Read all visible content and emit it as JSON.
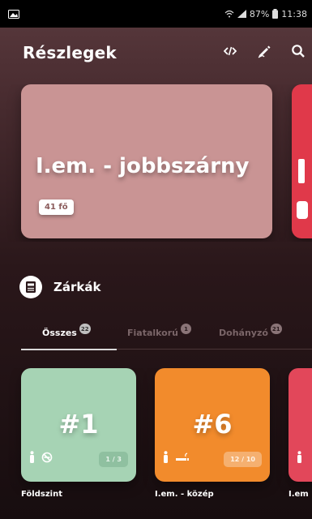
{
  "status": {
    "battery": "87%",
    "time": "11:38"
  },
  "appbar": {
    "title": "Részlegek",
    "icons": [
      "code-icon",
      "pen-icon",
      "search-icon"
    ]
  },
  "departments": [
    {
      "name": "I.em. - jobbszárny",
      "count": "41 fő",
      "color": "#c99494"
    },
    {
      "name": "",
      "count": "",
      "color": "#e0394a"
    }
  ],
  "section": {
    "title": "Zárkák",
    "icon": "cell-door-icon"
  },
  "tabs": [
    {
      "label": "Összes",
      "badge": "22",
      "active": true
    },
    {
      "label": "Fiatalkorú",
      "badge": "1",
      "active": false
    },
    {
      "label": "Dohányzó",
      "badge": "21",
      "active": false
    }
  ],
  "cells": [
    {
      "number": "#1",
      "occupancy": "1 / 3",
      "label": "Földszint",
      "color": "#a6d3b4",
      "pill": "#8fc0a0"
    },
    {
      "number": "#6",
      "occupancy": "12 / 10",
      "label": "I.em. - közép",
      "color": "#f28b2c",
      "pill": "#f5b070"
    },
    {
      "number": "",
      "occupancy": "",
      "label": "I.em",
      "color": "#e2475a",
      "pill": "#e2475a"
    }
  ],
  "colors": {
    "accent_active_tab": "#d9d9d9",
    "badge_count_text": "#8a5a5a"
  }
}
